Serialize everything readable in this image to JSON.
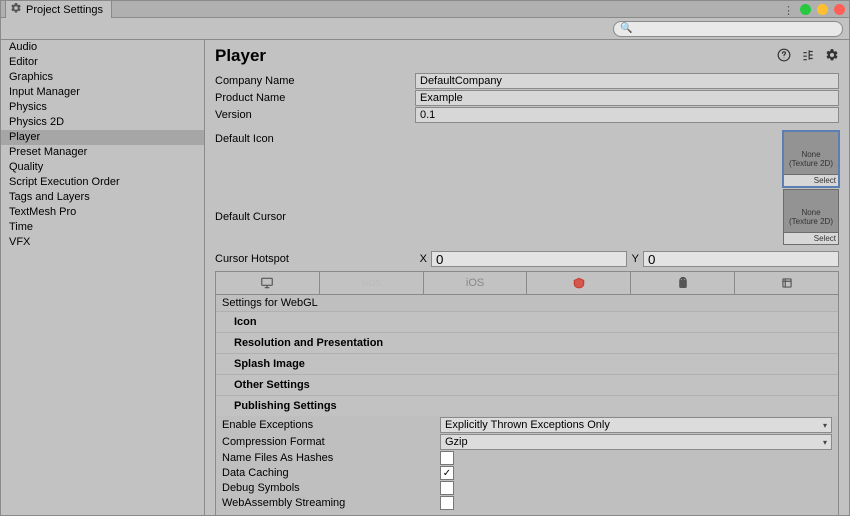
{
  "window": {
    "title": "Project Settings"
  },
  "search": {
    "placeholder": ""
  },
  "sidebar": {
    "items": [
      {
        "label": "Audio"
      },
      {
        "label": "Editor"
      },
      {
        "label": "Graphics"
      },
      {
        "label": "Input Manager"
      },
      {
        "label": "Physics"
      },
      {
        "label": "Physics 2D"
      },
      {
        "label": "Player",
        "selected": true
      },
      {
        "label": "Preset Manager"
      },
      {
        "label": "Quality"
      },
      {
        "label": "Script Execution Order"
      },
      {
        "label": "Tags and Layers"
      },
      {
        "label": "TextMesh Pro"
      },
      {
        "label": "Time"
      },
      {
        "label": "VFX"
      }
    ]
  },
  "header": {
    "title": "Player"
  },
  "form": {
    "company_name_label": "Company Name",
    "company_name_value": "DefaultCompany",
    "product_name_label": "Product Name",
    "product_name_value": "Example",
    "version_label": "Version",
    "version_value": "0.1",
    "default_icon_label": "Default Icon",
    "default_cursor_label": "Default Cursor",
    "slot_none_text": "None (Texture 2D)",
    "slot_select_label": "Select",
    "cursor_hotspot_label": "Cursor Hotspot",
    "cursor_x_label": "X",
    "cursor_x_value": "0",
    "cursor_y_label": "Y",
    "cursor_y_value": "0"
  },
  "platform_tabs": {
    "items": [
      {
        "name": "standalone"
      },
      {
        "name": "tvos",
        "label": "tvOS"
      },
      {
        "name": "ios",
        "label": "iOS"
      },
      {
        "name": "webgl",
        "active": true
      },
      {
        "name": "android"
      },
      {
        "name": "universal"
      }
    ]
  },
  "settings": {
    "group_title": "Settings for WebGL",
    "sections": {
      "icon": "Icon",
      "resolution": "Resolution and Presentation",
      "splash": "Splash Image",
      "other": "Other Settings",
      "publishing": "Publishing Settings"
    },
    "publishing": {
      "enable_exceptions_label": "Enable Exceptions",
      "enable_exceptions_value": "Explicitly Thrown Exceptions Only",
      "compression_label": "Compression Format",
      "compression_value": "Gzip",
      "name_files_label": "Name Files As Hashes",
      "name_files_value": false,
      "data_caching_label": "Data Caching",
      "data_caching_value": true,
      "debug_symbols_label": "Debug Symbols",
      "debug_symbols_value": false,
      "wasm_streaming_label": "WebAssembly Streaming",
      "wasm_streaming_value": false
    }
  }
}
